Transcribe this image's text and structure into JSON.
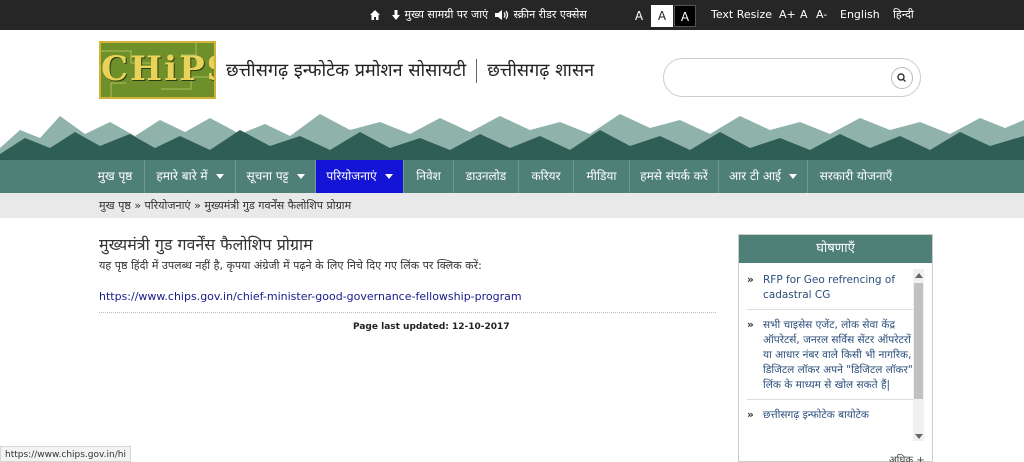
{
  "topbar": {
    "skip_main": "मुख्य सामग्री पर जाएं",
    "screen_reader": "स्क्रीन रीडर एक्सेस",
    "font_a": "A",
    "text_resize": "Text Resize",
    "a_plus": "A+",
    "a_normal": "A",
    "a_minus": "A-",
    "english": "English",
    "hindi": "हिन्दी"
  },
  "header": {
    "logo_text": "CHiPS",
    "title": "छत्तीसगढ़ इन्फोटेक प्रमोशन सोसायटी",
    "subtitle": "छत्तीसगढ़ शासन",
    "search_value": "",
    "search_placeholder": ""
  },
  "nav": {
    "items": [
      {
        "label": "मुख पृष्ठ"
      },
      {
        "label": "हमारे बारे में"
      },
      {
        "label": "सूचना पट्ट"
      },
      {
        "label": "परियोजनाएं"
      },
      {
        "label": "निवेश"
      },
      {
        "label": "डाउनलोड"
      },
      {
        "label": "करियर"
      },
      {
        "label": "मीडिया"
      },
      {
        "label": "हमसे संपर्क करें"
      },
      {
        "label": "आर टी आई"
      },
      {
        "label": "सरकारी योजनाएँ"
      }
    ]
  },
  "breadcrumb": {
    "home": "मुख पृष्ठ",
    "sep": "»",
    "section": "परियोजनाएं",
    "current": "मुख्यमंत्री गुड गवर्नेंस फैलोशिप प्रोग्राम"
  },
  "main": {
    "title": "मुख्यमंत्री गुड गवर्नेंस फैलोशिप प्रोग्राम",
    "note": "यह पृष्ठ हिंदी में उपलब्ध नहीं है, कृपया अंग्रेजी में पढ़ने के लिए निचे दिए गए लिंक पर क्लिक करें:",
    "link": "https://www.chips.gov.in/chief-minister-good-governance-fellowship-program",
    "updated_label": "Page last updated:",
    "updated_date": "12-10-2017"
  },
  "announcements": {
    "heading": "घोषणाएँ",
    "bullet": "»",
    "items": [
      "RFP for Geo refrencing of cadastral CG",
      "सभी चाइसेस एजेंट, लोक सेवा केंद्र ऑपरेटर्स, जनरल सर्विस सेंटर ऑपरेटरों या आधार नंबर वाले किसी भी नागरिक, डिजिटल लॉकर अपने \"डिजिटल लॉकर\" लिंक के माध्यम से खोल सकते हैं|",
      "छत्तीसगढ़ इन्फोटेक बायोटेक"
    ],
    "more": "अधिक +"
  },
  "status": {
    "url": "https://www.chips.gov.in/hi"
  },
  "colors": {
    "topbar": "#262626",
    "nav": "#4f8078",
    "nav_active": "#1414d6",
    "mountain_dark": "#2f5e55",
    "mountain_light": "#8fb2ab"
  }
}
